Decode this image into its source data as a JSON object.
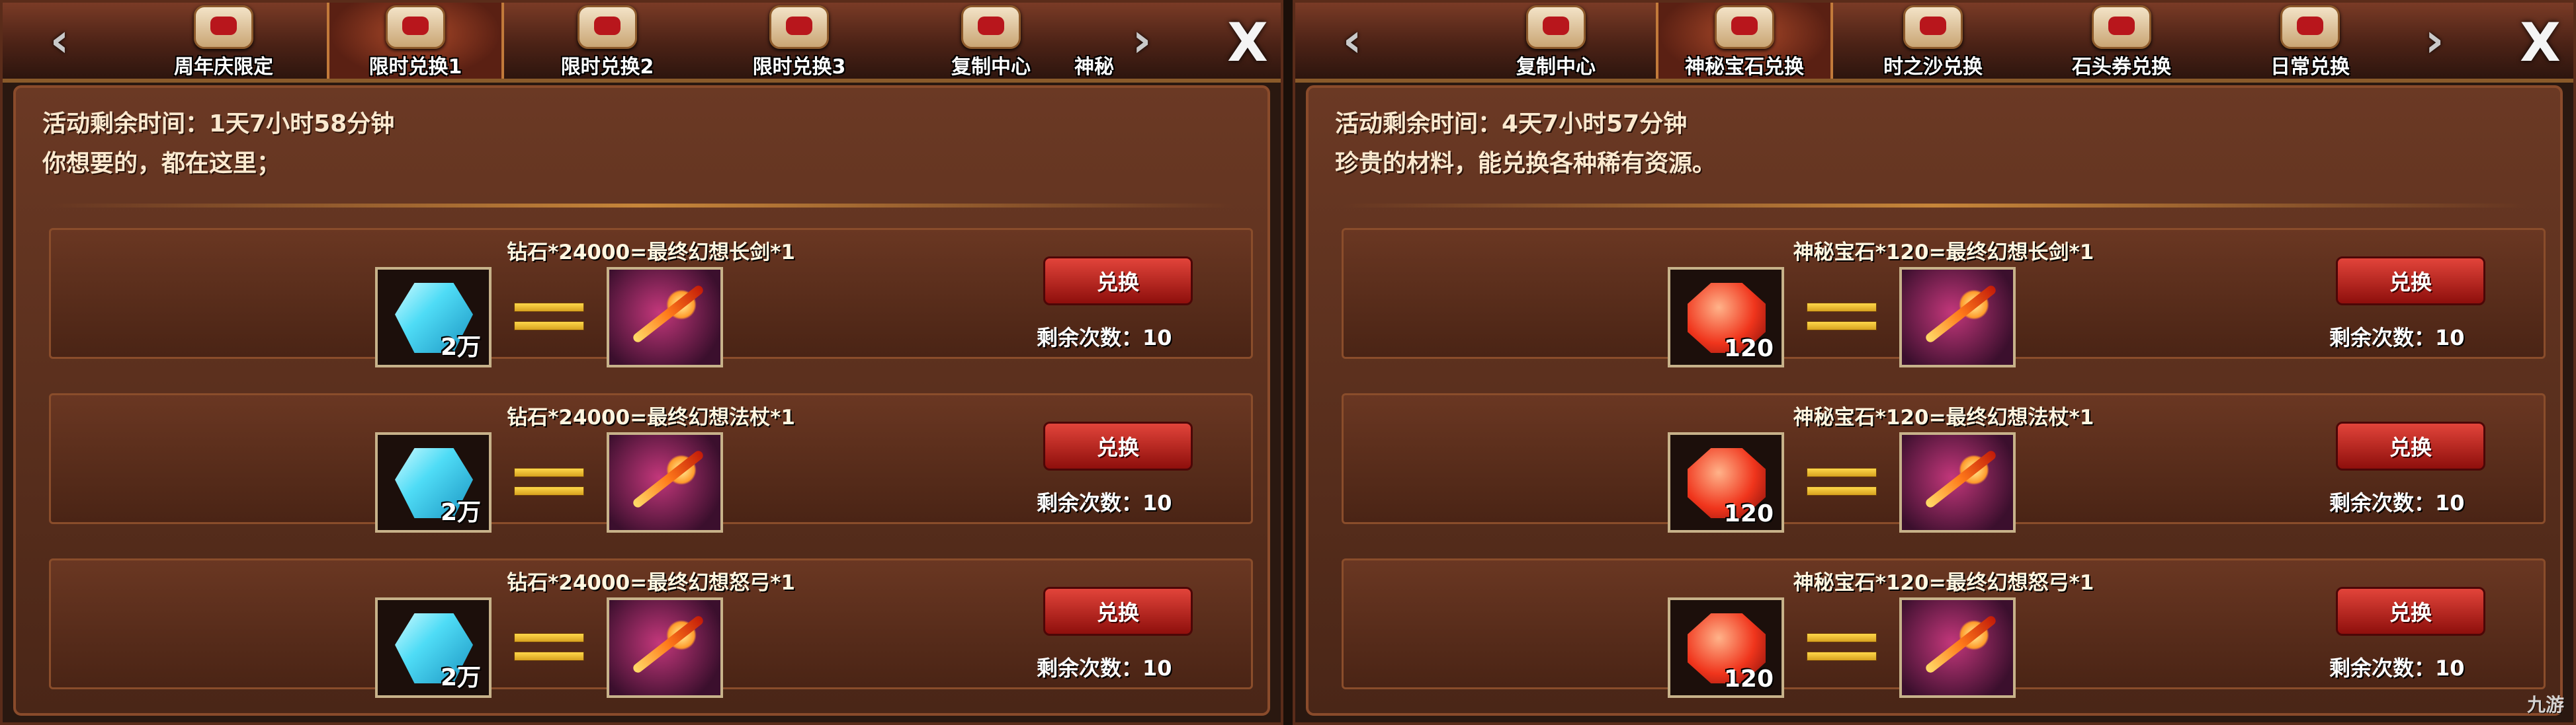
{
  "colors": {
    "accent_button": "#c0201c",
    "info_text": "#fbe9cf",
    "equals": "#ffd84a"
  },
  "panels": [
    {
      "tabs": [
        {
          "label": "周年庆限定",
          "active": false
        },
        {
          "label": "限时兑换1",
          "active": true
        },
        {
          "label": "限时兑换2",
          "active": false
        },
        {
          "label": "限时兑换3",
          "active": false
        },
        {
          "label": "复制中心",
          "active": false
        },
        {
          "label": "神秘",
          "active": false
        }
      ],
      "time_remaining": "活动剩余时间：1天7小时58分钟",
      "description": "你想要的，都在这里；",
      "rows": [
        {
          "title": "钻石*24000=最终幻想长剑*1",
          "cost_qty": "2万",
          "button": "兑换",
          "remaining": "剩余次数：10"
        },
        {
          "title": "钻石*24000=最终幻想法杖*1",
          "cost_qty": "2万",
          "button": "兑换",
          "remaining": "剩余次数：10"
        },
        {
          "title": "钻石*24000=最终幻想怒弓*1",
          "cost_qty": "2万",
          "button": "兑换",
          "remaining": "剩余次数：10"
        }
      ]
    },
    {
      "tabs": [
        {
          "label": "复制中心",
          "active": false
        },
        {
          "label": "神秘宝石兑换",
          "active": true
        },
        {
          "label": "时之沙兑换",
          "active": false
        },
        {
          "label": "石头券兑换",
          "active": false
        },
        {
          "label": "日常兑换",
          "active": false
        }
      ],
      "time_remaining": "活动剩余时间：4天7小时57分钟",
      "description": "珍贵的材料，能兑换各种稀有资源。",
      "rows": [
        {
          "title": "神秘宝石*120=最终幻想长剑*1",
          "cost_qty": "120",
          "button": "兑换",
          "remaining": "剩余次数：10"
        },
        {
          "title": "神秘宝石*120=最终幻想法杖*1",
          "cost_qty": "120",
          "button": "兑换",
          "remaining": "剩余次数：10"
        },
        {
          "title": "神秘宝石*120=最终幻想怒弓*1",
          "cost_qty": "120",
          "button": "兑换",
          "remaining": "剩余次数：10"
        }
      ]
    }
  ],
  "nav": {
    "prev_icon": "‹",
    "next_icon": "›",
    "close_icon": "X"
  },
  "watermark": "九游"
}
